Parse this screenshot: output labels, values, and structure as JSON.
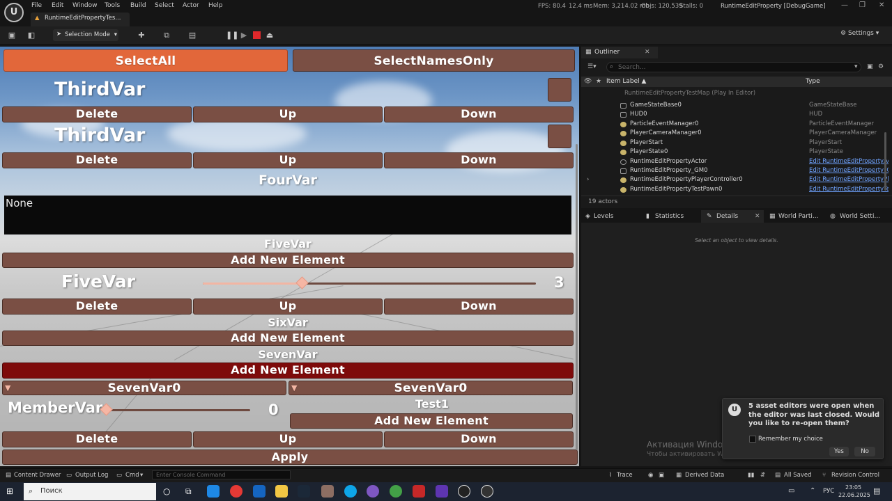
{
  "menu": [
    "File",
    "Edit",
    "Window",
    "Tools",
    "Build",
    "Select",
    "Actor",
    "Help"
  ],
  "stats": {
    "fps": "FPS: 80.4",
    "ms": "12.4 ms",
    "mem": "Mem: 3,214.02 mb",
    "objs": "Objs: 120,539",
    "stalls": "Stalls: 0"
  },
  "window_title": "RuntimeEditProperty [DebugGame]",
  "asset_tab": "RuntimeEditPropertyTes...",
  "toolbar": {
    "selection_mode": "Selection Mode",
    "settings": "Settings"
  },
  "viewport": {
    "select_all": "SelectAll",
    "select_names_only": "SelectNamesOnly",
    "third_var_1": "ThirdVar",
    "third_var_2": "ThirdVar",
    "delete": "Delete",
    "up": "Up",
    "down": "Down",
    "four_var": "FourVar",
    "four_var_value": "None",
    "five_var_header": "FiveVar",
    "add_new_element": "Add New Element",
    "five_var_label": "FiveVar",
    "five_var_value": "3",
    "five_var_slider_fraction": 0.3,
    "six_var": "SixVar",
    "seven_var": "SevenVar",
    "seven_var0_a": "SevenVar0",
    "seven_var0_b": "SevenVar0",
    "member_var": "MemberVar",
    "member_var_value": "0",
    "member_var_slider_fraction": 0.0,
    "test1": "Test1",
    "apply": "Apply"
  },
  "outliner": {
    "title": "Outliner",
    "search_placeholder": "Search...",
    "col_label": "Item Label ▲",
    "col_type": "Type",
    "map": "RuntimeEditPropertyTestMap (Play In Editor)",
    "rows": [
      {
        "name": "GameStateBase0",
        "type": "GameStateBase",
        "link": false
      },
      {
        "name": "HUD0",
        "type": "HUD",
        "link": false
      },
      {
        "name": "ParticleEventManager0",
        "type": "ParticleEventManager",
        "link": false
      },
      {
        "name": "PlayerCameraManager0",
        "type": "PlayerCameraManager",
        "link": false
      },
      {
        "name": "PlayerStart",
        "type": "PlayerStart",
        "link": false
      },
      {
        "name": "PlayerState0",
        "type": "PlayerState",
        "link": false
      },
      {
        "name": "RuntimeEditPropertyActor",
        "type": "Edit RuntimeEditPropertyAct",
        "link": true
      },
      {
        "name": "RuntimeEditProperty_GM0",
        "type": "Edit RuntimeEditProperty_GM",
        "link": true
      },
      {
        "name": "RuntimeEditPropertyPlayerController0",
        "type": "Edit RuntimeEditPropertyPlay",
        "link": true
      },
      {
        "name": "RuntimeEditPropertyTestPawn0",
        "type": "Edit RuntimeEditPropertyTes",
        "link": true
      }
    ],
    "actor_count": "19 actors"
  },
  "details_tabs": [
    "Levels",
    "Statistics",
    "Details",
    "World Parti...",
    "World Setti..."
  ],
  "details_empty": "Select an object to view details.",
  "notification": {
    "text": "5 asset editors were open when the editor was last closed. Would you like to re-open them?",
    "remember": "Remember my choice",
    "yes": "Yes",
    "no": "No"
  },
  "watermark": {
    "title": "Активация Windows",
    "sub": "Чтобы активировать Windows, перейдите в раздел \"Параметры\"."
  },
  "statusbar": {
    "content_drawer": "Content Drawer",
    "output_log": "Output Log",
    "cmd": "Cmd",
    "console_placeholder": "Enter Console Command",
    "trace": "Trace",
    "derived_data": "Derived Data",
    "all_saved": "All Saved",
    "revision_control": "Revision Control"
  },
  "taskbar": {
    "search": "Поиск",
    "lang": "РУС",
    "time": "23:05",
    "date": "22.06.2025"
  }
}
